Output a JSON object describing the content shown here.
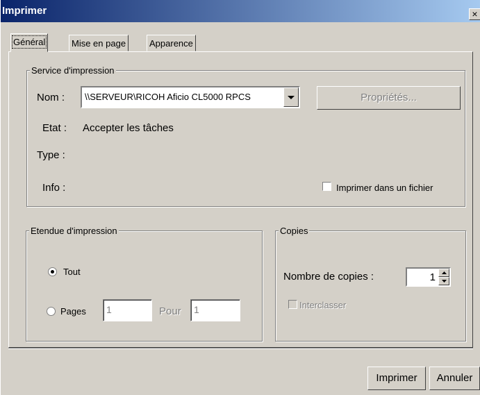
{
  "window": {
    "title": "Imprimer",
    "close": "×"
  },
  "tabs": [
    {
      "label": "Général",
      "active": true
    },
    {
      "label": "Mise en page",
      "active": false
    },
    {
      "label": "Apparence",
      "active": false
    }
  ],
  "service": {
    "group_title": "Service d'impression",
    "name_label": "Nom :",
    "printer": "\\\\SERVEUR\\RICOH Aficio CL5000 RPCS",
    "properties_button": "Propriétés...",
    "state_label": "Etat :",
    "state_value": "Accepter les tâches",
    "type_label": "Type :",
    "info_label": "Info :",
    "print_to_file_label": "Imprimer dans un fichier"
  },
  "range": {
    "group_title": "Etendue d'impression",
    "all_label": "Tout",
    "pages_label": "Pages",
    "from_value": "1",
    "to_label": "Pour",
    "to_value": "1"
  },
  "copies": {
    "group_title": "Copies",
    "count_label": "Nombre de copies :",
    "count_value": "1",
    "collate_label": "Interclasser"
  },
  "buttons": {
    "print": "Imprimer",
    "cancel": "Annuler"
  }
}
